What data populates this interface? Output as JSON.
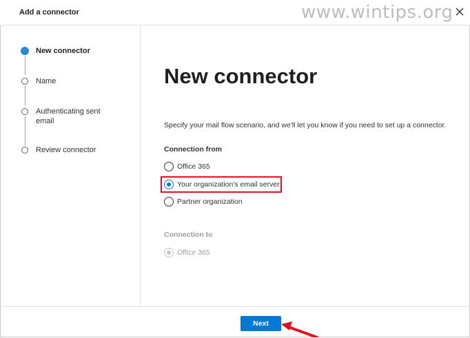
{
  "panel": {
    "title": "Add a connector",
    "watermark": "www.wintips.org",
    "close_icon": "close-icon"
  },
  "steps": [
    {
      "label": "New connector",
      "active": true
    },
    {
      "label": "Name",
      "active": false
    },
    {
      "label": "Authenticating sent",
      "label2": "email",
      "active": false
    },
    {
      "label": "Review connector",
      "active": false
    }
  ],
  "main": {
    "title": "New connector",
    "description": "Specify your mail flow scenario, and we'll let you know if you need to set up a connector.",
    "connection_from": {
      "label": "Connection from",
      "options": [
        {
          "label": "Office 365",
          "checked": false
        },
        {
          "label": "Your organization's email server",
          "checked": true
        },
        {
          "label": "Partner organization",
          "checked": false
        }
      ]
    },
    "connection_to": {
      "label": "Connection to",
      "options": [
        {
          "label": "Office 365",
          "checked": true,
          "disabled": true
        }
      ]
    }
  },
  "footer": {
    "next_label": "Next"
  },
  "colors": {
    "accent": "#0078d4",
    "highlight": "#e3101e",
    "step_active": "#2b88d8"
  }
}
